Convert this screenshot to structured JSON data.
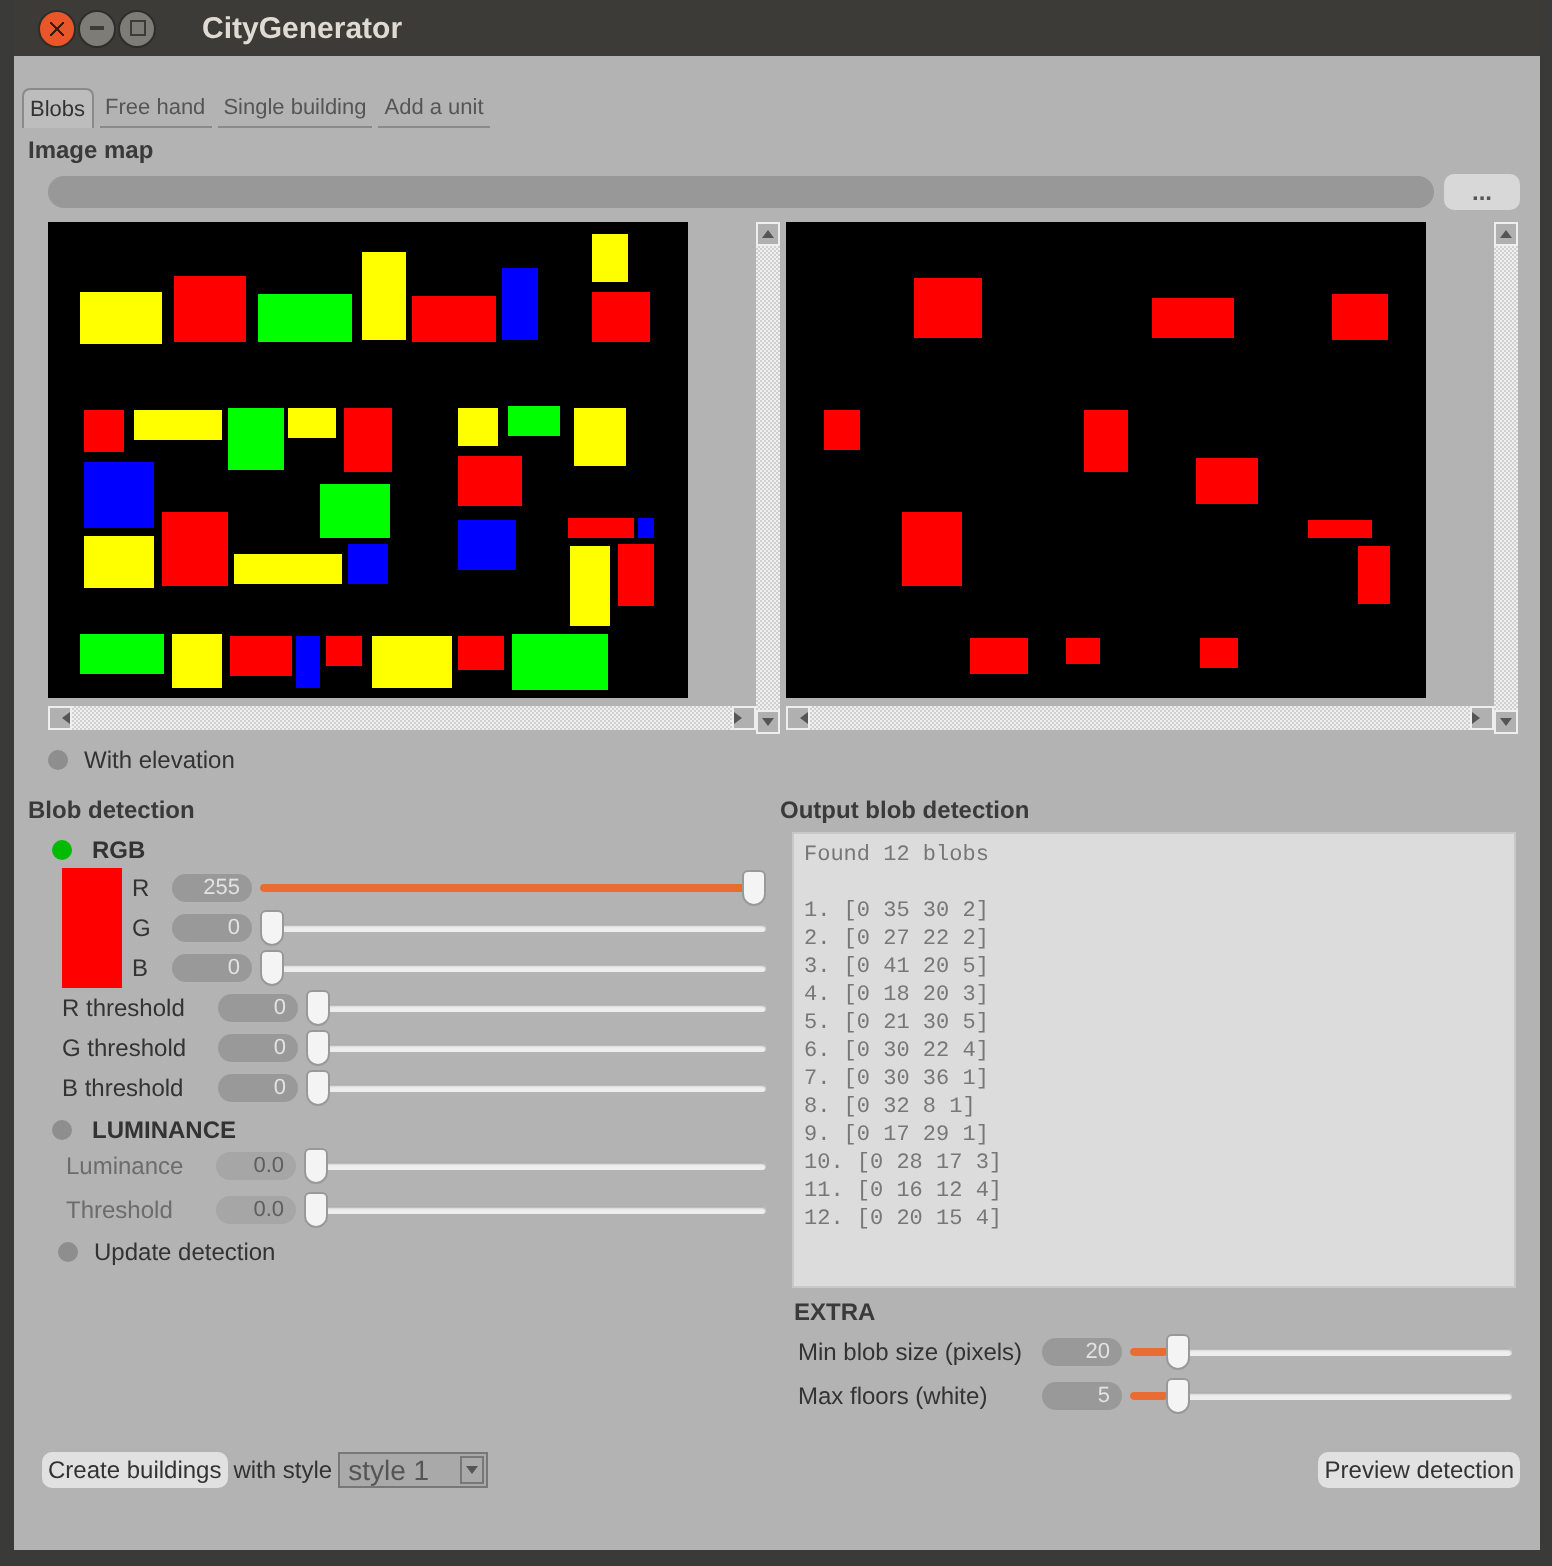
{
  "window": {
    "title": "CityGenerator"
  },
  "tabs": [
    {
      "label": "Blobs",
      "selected": true
    },
    {
      "label": "Free hand",
      "selected": false
    },
    {
      "label": "Single building",
      "selected": false
    },
    {
      "label": "Add a unit",
      "selected": false
    }
  ],
  "image_map": {
    "title": "Image map",
    "browse_button": "..."
  },
  "with_elevation": {
    "label": "With elevation",
    "on": false
  },
  "blob_detection": {
    "title": "Blob detection",
    "rgb": {
      "label": "RGB",
      "selected": true,
      "color": "#ff0000",
      "channels": [
        {
          "label": "R",
          "value": "255",
          "level": 1
        },
        {
          "label": "G",
          "value": "0",
          "level": 0
        },
        {
          "label": "B",
          "value": "0",
          "level": 0
        }
      ],
      "thresholds": [
        {
          "label": "R threshold",
          "value": "0",
          "level": 0
        },
        {
          "label": "G threshold",
          "value": "0",
          "level": 0
        },
        {
          "label": "B threshold",
          "value": "0",
          "level": 0
        }
      ]
    },
    "luminance": {
      "label": "LUMINANCE",
      "selected": false,
      "sliders": [
        {
          "label": "Luminance",
          "value": "0.0",
          "level": 0,
          "disabled": true
        },
        {
          "label": "Threshold",
          "value": "0.0",
          "level": 0,
          "disabled": true
        }
      ]
    },
    "update_detection": {
      "label": "Update detection",
      "on": false
    }
  },
  "output": {
    "title": "Output blob detection",
    "summary": "Found 12 blobs",
    "blobs": [
      "1. [0 35 30 2]",
      "2. [0 27 22 2]",
      "3. [0 41 20 5]",
      "4. [0 18 20 3]",
      "5. [0 21 30 5]",
      "6. [0 30 22 4]",
      "7. [0 30 36 1]",
      "8. [0 32 8 1]",
      "9. [0 17 29 1]",
      "10. [0 28 17 3]",
      "11. [0 16 12 4]",
      "12. [0 20 15 4]"
    ]
  },
  "extra": {
    "title": "EXTRA",
    "sliders": [
      {
        "label": "Min blob size (pixels)",
        "value": "20",
        "level": 0.1
      },
      {
        "label": "Max floors (white)",
        "value": "5",
        "level": 0.1
      }
    ]
  },
  "footer": {
    "create_button": "Create buildings",
    "style_label": "with style",
    "style_select": "style 1",
    "preview_button": "Preview detection"
  }
}
